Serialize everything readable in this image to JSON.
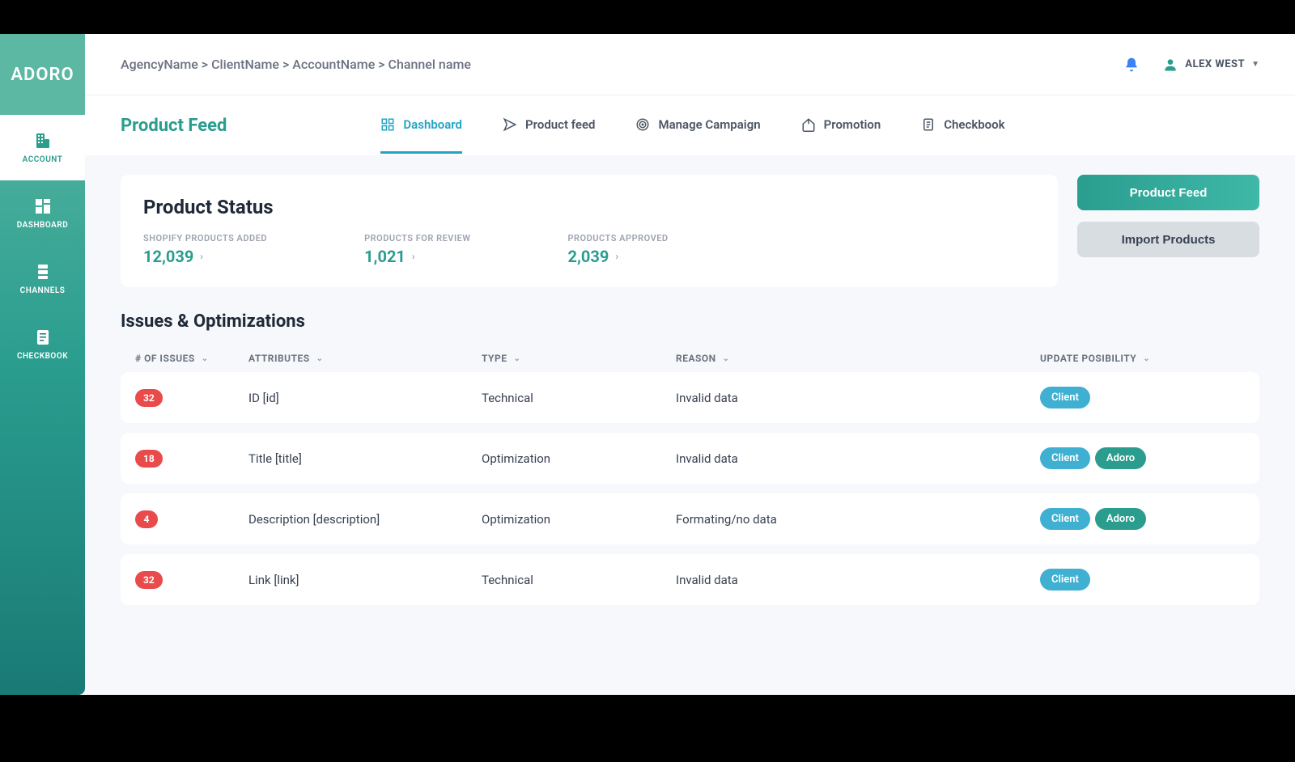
{
  "brand": "ADORO",
  "sidebar": {
    "items": [
      {
        "label": "ACCOUNT"
      },
      {
        "label": "DASHBOARD"
      },
      {
        "label": "CHANNELS"
      },
      {
        "label": "CHECKBOOK"
      }
    ]
  },
  "breadcrumb": "AgencyName > ClientName > AccountName > Channel name",
  "user": {
    "name": "ALEX WEST"
  },
  "page_title": "Product Feed",
  "tabs": [
    {
      "label": "Dashboard"
    },
    {
      "label": "Product feed"
    },
    {
      "label": "Manage Campaign"
    },
    {
      "label": "Promotion"
    },
    {
      "label": "Checkbook"
    }
  ],
  "status": {
    "title": "Product Status",
    "stats": [
      {
        "label": "SHOPIFY PRODUCTS ADDED",
        "value": "12,039"
      },
      {
        "label": "PRODUCTS FOR REVIEW",
        "value": "1,021"
      },
      {
        "label": "PRODUCTS APPROVED",
        "value": "2,039"
      }
    ]
  },
  "actions": {
    "primary": "Product Feed",
    "secondary": "Import Products"
  },
  "issues": {
    "title": "Issues & Optimizations",
    "columns": [
      "# OF ISSUES",
      "ATTRIBUTES",
      "TYPE",
      "REASON",
      "UPDATE POSIBILITY"
    ],
    "rows": [
      {
        "count": "32",
        "attribute": "ID [id]",
        "type": "Technical",
        "reason": "Invalid data",
        "pills": [
          "Client"
        ]
      },
      {
        "count": "18",
        "attribute": "Title [title]",
        "type": "Optimization",
        "reason": "Invalid data",
        "pills": [
          "Client",
          "Adoro"
        ]
      },
      {
        "count": "4",
        "attribute": "Description [description]",
        "type": "Optimization",
        "reason": "Formating/no data",
        "pills": [
          "Client",
          "Adoro"
        ]
      },
      {
        "count": "32",
        "attribute": "Link [link]",
        "type": "Technical",
        "reason": "Invalid data",
        "pills": [
          "Client"
        ]
      }
    ]
  }
}
